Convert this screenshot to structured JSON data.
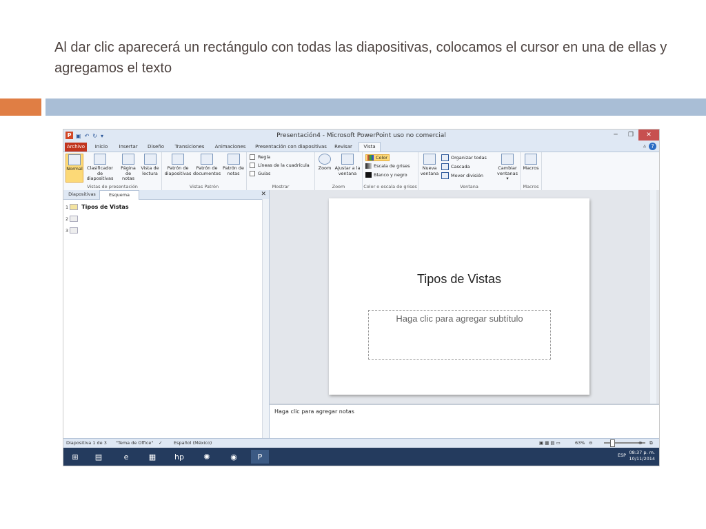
{
  "caption": "Al dar clic aparecerá un rectángulo con todas las diapositivas, colocamos el cursor en una de ellas y agregamos el texto",
  "window": {
    "title": "Presentación4 - Microsoft PowerPoint uso no comercial",
    "app_icon": "P"
  },
  "tabs": [
    "Archivo",
    "Inicio",
    "Insertar",
    "Diseño",
    "Transiciones",
    "Animaciones",
    "Presentación con diapositivas",
    "Revisar",
    "Vista"
  ],
  "ribbon": {
    "vistas_presentacion": {
      "label": "Vistas de presentación",
      "buttons": [
        "Normal",
        "Clasificador de diapositivas",
        "Página de notas",
        "Vista de lectura"
      ]
    },
    "vistas_patron": {
      "label": "Vistas Patrón",
      "buttons": [
        "Patrón de diapositivas",
        "Patrón de documentos",
        "Patrón de notas"
      ]
    },
    "mostrar": {
      "label": "Mostrar",
      "checks": [
        "Regla",
        "Líneas de la cuadrícula",
        "Guías"
      ]
    },
    "zoom": {
      "label": "Zoom",
      "buttons": [
        "Zoom",
        "Ajustar a la ventana"
      ]
    },
    "color": {
      "label": "Color o escala de grises",
      "options": [
        "Color",
        "Escala de grises",
        "Blanco y negro"
      ]
    },
    "ventana": {
      "label": "Ventana",
      "new_window": "Nueva ventana",
      "options": [
        "Organizar todas",
        "Cascada",
        "Mover división"
      ],
      "switch": "Cambiar ventanas"
    },
    "macros": {
      "label": "Macros",
      "button": "Macros"
    }
  },
  "left_pane": {
    "tabs": [
      "Diapositivas",
      "Esquema"
    ],
    "outline": [
      {
        "num": "1",
        "text": "Tipos  de Vistas"
      },
      {
        "num": "2",
        "text": ""
      },
      {
        "num": "3",
        "text": ""
      }
    ]
  },
  "slide": {
    "title": "Tipos de Vistas",
    "subtitle_placeholder": "Haga clic para agregar subtítulo"
  },
  "notes_placeholder": "Haga clic para agregar notas",
  "status": {
    "slide": "Diapositiva 1 de 3",
    "theme": "\"Tema de Office\"",
    "language": "Español (México)",
    "zoom": "63%"
  },
  "taskbar": {
    "lang": "ESP",
    "time": "08:37 p. m.",
    "date": "10/11/2014"
  },
  "colors": {
    "accent_orange": "#e07e44",
    "accent_blue": "#a9bed6",
    "file_tab": "#c1341d"
  }
}
